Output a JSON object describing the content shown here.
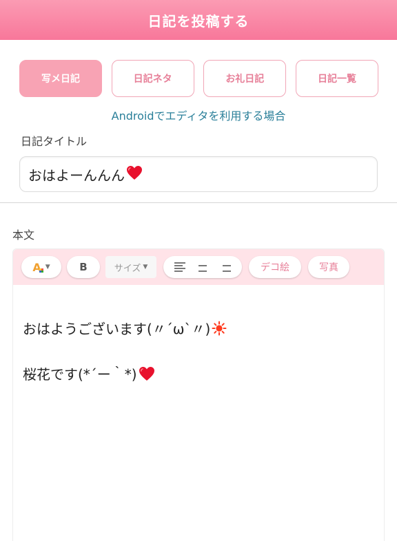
{
  "header": {
    "title": "日記を投稿する"
  },
  "tabs": [
    {
      "label": "写メ日記",
      "active": true
    },
    {
      "label": "日記ネタ",
      "active": false
    },
    {
      "label": "お礼日記",
      "active": false
    },
    {
      "label": "日記一覧",
      "active": false
    }
  ],
  "android_link": "Androidでエディタを利用する場合",
  "title_field": {
    "label": "日記タイトル",
    "value": "おはよーんんん"
  },
  "body_field": {
    "label": "本文"
  },
  "toolbar": {
    "color_icon": "font-color-icon",
    "bold_label": "B",
    "size_label": "サイズ",
    "align_icons": [
      "align-left-icon",
      "align-center-icon",
      "align-right-icon"
    ],
    "deco_label": "デコ絵",
    "photo_label": "写真"
  },
  "editor": {
    "line1": "おはようございます(〃´ω`〃)",
    "line1_emoji": "sun-icon",
    "line2": "桜花です(*´ー｀*)",
    "line2_emoji": "heart-icon"
  },
  "colors": {
    "accent": "#f8779a",
    "tab_active": "#f8a3b4",
    "link": "#2a7f99",
    "toolbar_bg": "#ffe3e8"
  }
}
